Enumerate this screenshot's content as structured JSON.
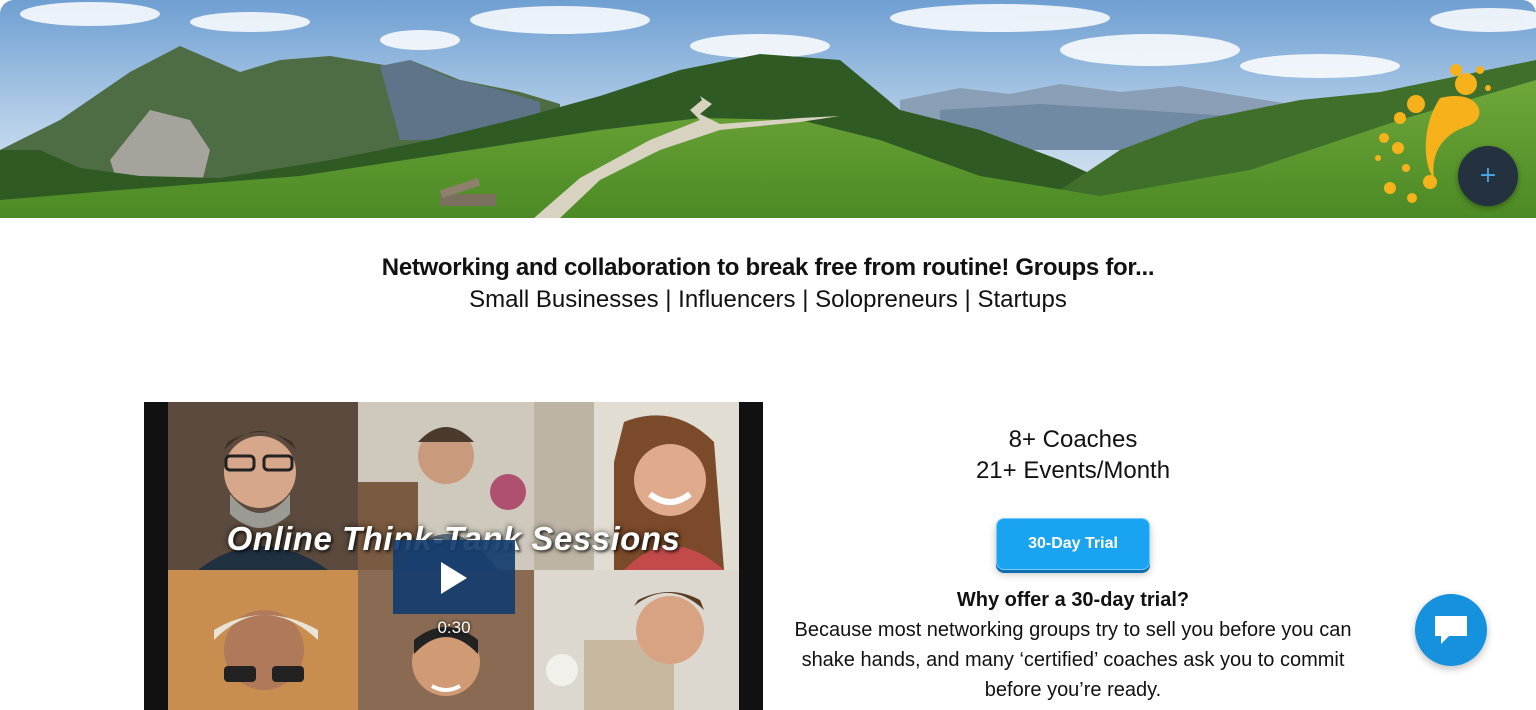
{
  "hero": {
    "scene": "alpine-meadow-trail",
    "fab_label": "+"
  },
  "tagline": {
    "headline": "Networking and collaboration to break free from routine! Groups for...",
    "audiences": "Small Businesses | Influencers | Solopreneurs | Startups"
  },
  "video": {
    "caption": "Online Think-Tank Sessions",
    "duration": "0:30",
    "play_icon": "play-icon"
  },
  "stats": {
    "coaches": "8+ Coaches",
    "events": "21+ Events/Month"
  },
  "cta": {
    "trial_label": "30-Day Trial",
    "why_title": "Why offer a 30-day trial?",
    "why_body": "Because most networking groups try to sell you before you can shake hands, and many ‘certified’ coaches ask you to commit before you’re ready."
  },
  "chat": {
    "icon": "chat-bubble-icon"
  },
  "colors": {
    "accent": "#1aa3f0",
    "chat": "#1591dd",
    "logo": "#f7b21b",
    "fab": "#24313f"
  }
}
